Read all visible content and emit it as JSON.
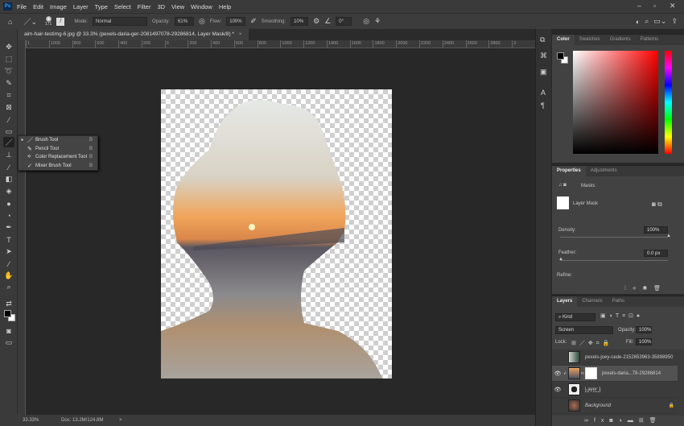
{
  "app": {
    "logo": "Ps",
    "menu": [
      "File",
      "Edit",
      "Image",
      "Layer",
      "Type",
      "Select",
      "Filter",
      "3D",
      "View",
      "Window",
      "Help"
    ],
    "window_controls": [
      "minimize",
      "restore",
      "close"
    ]
  },
  "options": {
    "brush_size": "171",
    "mode_label": "Mode:",
    "mode": "Normal",
    "opacity_label": "Opacity:",
    "opacity": "61%",
    "flow_label": "Flow:",
    "flow": "100%",
    "smoothing_label": "Smoothing:",
    "smoothing": "10%",
    "angle": "0°"
  },
  "document": {
    "tab_title": "aim-hair-testimg-6.jpg @ 33.3% (pexels-daria-ger-2081497078-29286814, Layer Mask/8) *",
    "close": "×"
  },
  "ruler": [
    "1",
    "1000",
    "800",
    "600",
    "400",
    "200",
    "0",
    "200",
    "400",
    "600",
    "800",
    "1000",
    "1200",
    "1400",
    "1600",
    "1800",
    "2000",
    "2200",
    "2400",
    "2600",
    "2800",
    "3"
  ],
  "tool_flyout": [
    {
      "label": "Brush Tool",
      "key": "B",
      "selected": true
    },
    {
      "label": "Pencil Tool",
      "key": "B"
    },
    {
      "label": "Color Replacement Tool",
      "key": "B"
    },
    {
      "label": "Mixer Brush Tool",
      "key": "B"
    }
  ],
  "status": {
    "zoom": "33.33%",
    "doc": "Doc: 13.2M/124.8M",
    "arrow": ">"
  },
  "color_panel": {
    "tabs": [
      "Color",
      "Swatches",
      "Gradients",
      "Patterns"
    ],
    "active": "Color",
    "hue_color": "#ff0000"
  },
  "properties": {
    "tabs": [
      "Properties",
      "Adjustments"
    ],
    "section": "Masks",
    "mask_name": "Layer Mask",
    "density_label": "Density:",
    "density": "100%",
    "density_value": 1.0,
    "feather_label": "Feather:",
    "feather": "0.0 px",
    "feather_value": 0,
    "refine_label": "Refine:"
  },
  "layers": {
    "tabs": [
      "Layers",
      "Channels",
      "Paths"
    ],
    "filter": "Kind",
    "blend": "Screen",
    "opacity_label": "Opacity:",
    "opacity": "100%",
    "lock_label": "Lock:",
    "fill_label": "Fill:",
    "fill": "100%",
    "items": [
      {
        "name": "pexels-joey-cede-2152653963-35898950",
        "visible": false
      },
      {
        "name": "pexels-daria...78-29286814",
        "visible": true,
        "selected": true
      },
      {
        "name": "Layer 1",
        "visible": true
      },
      {
        "name": "Background",
        "visible": false,
        "locked": true
      }
    ]
  }
}
